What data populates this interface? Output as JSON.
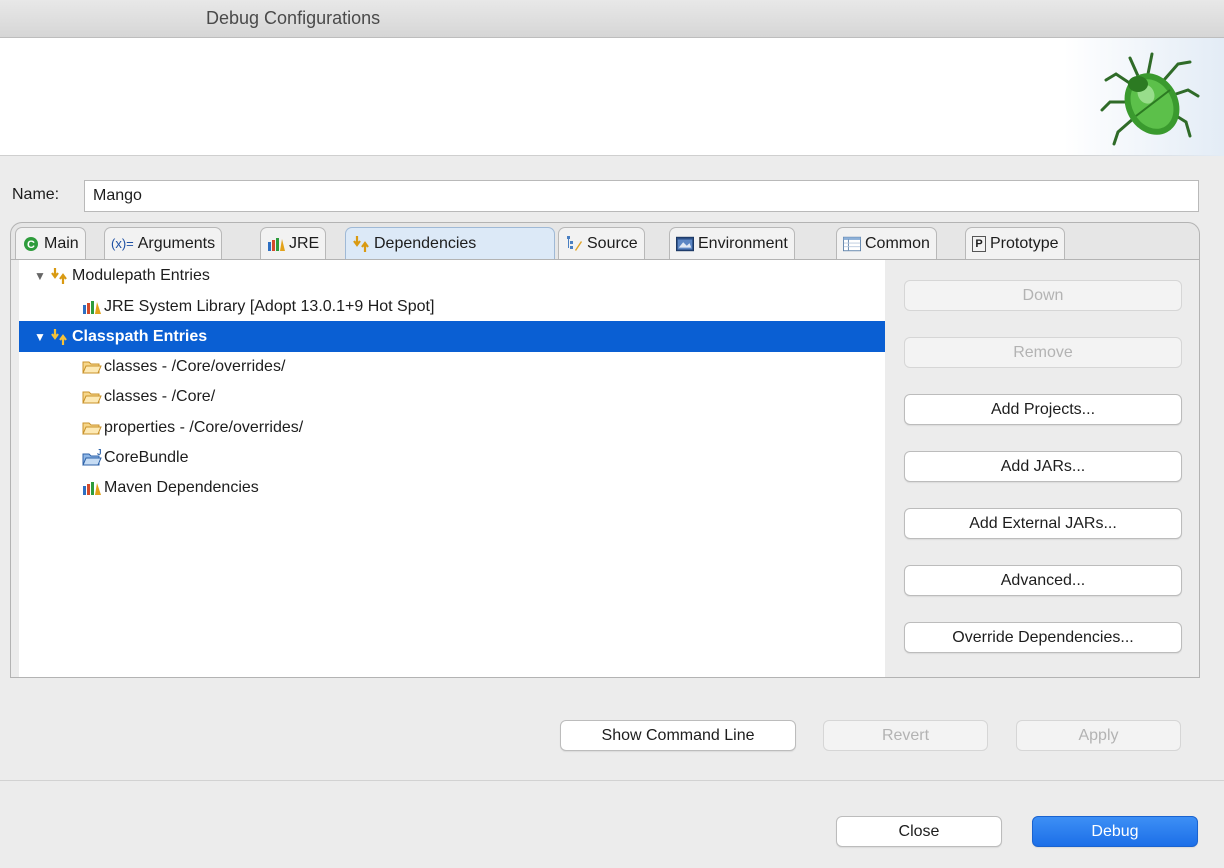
{
  "window": {
    "title": "Debug Configurations"
  },
  "name_field": {
    "label": "Name:",
    "value": "Mango"
  },
  "tabs": [
    {
      "label": "Main",
      "icon": "main-tab-icon"
    },
    {
      "label": "Arguments",
      "icon": "arguments-icon",
      "prefix": "(x)="
    },
    {
      "label": "JRE",
      "icon": "jre-library-icon"
    },
    {
      "label": "Dependencies",
      "icon": "dependencies-icon",
      "active": true
    },
    {
      "label": "Source",
      "icon": "source-icon"
    },
    {
      "label": "Environment",
      "icon": "environment-icon"
    },
    {
      "label": "Common",
      "icon": "common-icon"
    },
    {
      "label": "Prototype",
      "icon": "prototype-icon",
      "prefix": "P"
    }
  ],
  "tree": {
    "modulepath": {
      "label": "Modulepath Entries"
    },
    "jre": {
      "label": "JRE System Library [Adopt 13.0.1+9 Hot Spot]"
    },
    "classpath": {
      "label": "Classpath Entries",
      "selected": true
    },
    "items": [
      {
        "label": "classes - /Core/overrides/",
        "icon": "folder-icon"
      },
      {
        "label": "classes - /Core/",
        "icon": "folder-icon"
      },
      {
        "label": "properties - /Core/overrides/",
        "icon": "folder-icon"
      },
      {
        "label": "CoreBundle",
        "icon": "project-folder-icon"
      },
      {
        "label": "Maven Dependencies",
        "icon": "library-icon"
      }
    ]
  },
  "side_buttons": {
    "down": "Down",
    "remove": "Remove",
    "add_projects": "Add Projects...",
    "add_jars": "Add JARs...",
    "add_external_jars": "Add External JARs...",
    "advanced": "Advanced...",
    "override_dependencies": "Override Dependencies..."
  },
  "action_buttons": {
    "show_command_line": "Show Command Line",
    "revert": "Revert",
    "apply": "Apply"
  },
  "dialog_buttons": {
    "close": "Close",
    "debug": "Debug"
  },
  "colors": {
    "selection": "#0a5fd3",
    "primary_button": "#1c6fe8",
    "bug_green": "#3a9a2e"
  }
}
